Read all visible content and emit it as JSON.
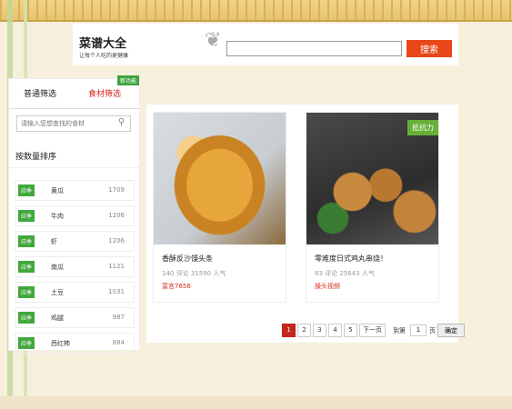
{
  "header": {
    "title": "菜谱大全",
    "subtitle": "让每个人吃的更健康",
    "search_placeholder": "",
    "search_button": "搜索"
  },
  "sidebar": {
    "tabs": [
      {
        "label": "普通筛选"
      },
      {
        "label": "食材筛选"
      }
    ],
    "new_badge": "新功能",
    "search_placeholder": "请输入您想查找的食材",
    "sort_title": "按数量排序",
    "items": [
      {
        "tag": "应季",
        "name": "黄瓜",
        "count": "1709"
      },
      {
        "tag": "应季",
        "name": "牛肉",
        "count": "1206"
      },
      {
        "tag": "应季",
        "name": "虾",
        "count": "1206"
      },
      {
        "tag": "应季",
        "name": "南瓜",
        "count": "1121"
      },
      {
        "tag": "应季",
        "name": "土豆",
        "count": "1031"
      },
      {
        "tag": "应季",
        "name": "鸡腿",
        "count": "987"
      },
      {
        "tag": "应季",
        "name": "西红柿",
        "count": "884"
      }
    ]
  },
  "cards": [
    {
      "title": "香酥反沙馒头条",
      "meta": "140 评论 31590 人气",
      "author": "富言7656",
      "badge": ""
    },
    {
      "title": "零难度日式鸡丸串烧！",
      "meta": "83 评论 25643 人气",
      "author": "操头视频",
      "badge": "抵抗力"
    }
  ],
  "pager": {
    "pages": [
      "1",
      "2",
      "3",
      "4",
      "5"
    ],
    "next": "下一页",
    "goto_prefix": "到第",
    "goto_value": "1",
    "goto_suffix": "页",
    "confirm": "确定"
  }
}
